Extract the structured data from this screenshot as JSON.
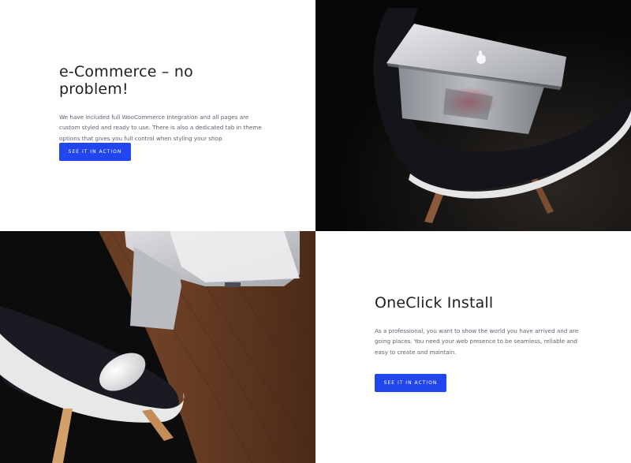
{
  "feature_ecommerce": {
    "title": "e-Commerce – no problem!",
    "description": "We have included full WooCommerce Integration and all pages are custom styled and ready to use. There is also a dedicated tab in theme options that gives you full control when styling your shop.",
    "button_label": "SEE IT IN ACTION"
  },
  "feature_oneclick": {
    "title": "OneClick Install",
    "description": "As a professional, you want to show the world you have arrived and are going places. You need your web presence to be seamless, reliable and easy to create and maintain.",
    "button_label": "SEE IT IN ACTION"
  },
  "colors": {
    "accent": "#2146f0",
    "heading": "#1e1e22",
    "body_text": "#5c6370"
  },
  "images": {
    "photo_top_right": "laptop-on-chair-photo",
    "photo_bottom_left": "laptop-and-mouse-on-desk-photo"
  }
}
